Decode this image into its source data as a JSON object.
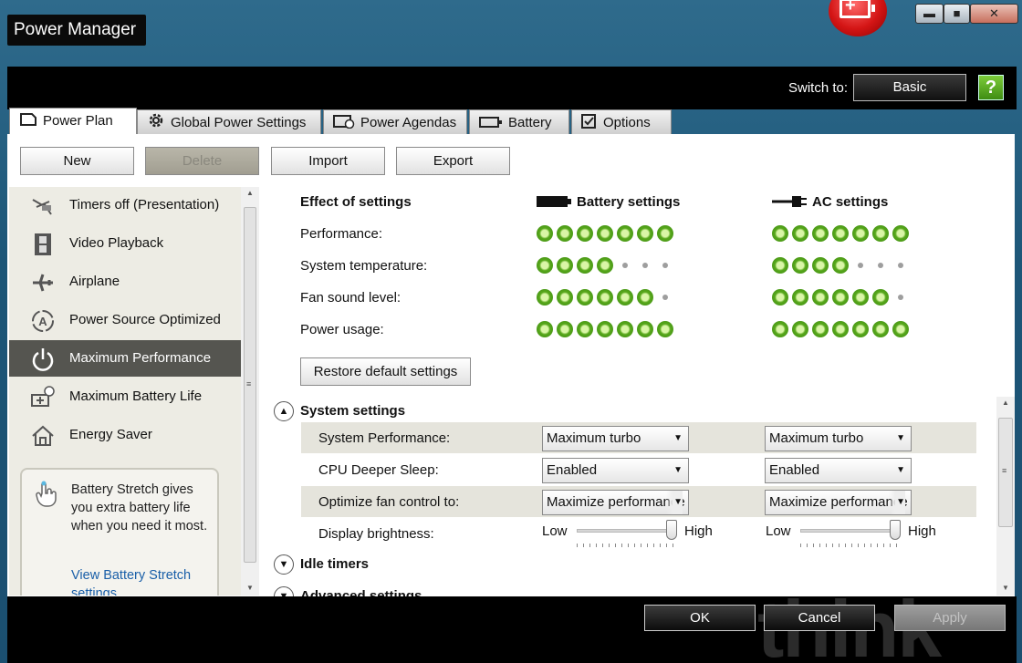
{
  "window": {
    "title": "Power Manager",
    "min_glyph": "▬",
    "max_glyph": "■",
    "close_glyph": "✕"
  },
  "topbar": {
    "switch_label": "Switch to:",
    "switch_button": "Basic",
    "help_glyph": "?"
  },
  "tabs": [
    {
      "label": "Power Plan",
      "icon": "page-icon",
      "active": true
    },
    {
      "label": "Global Power Settings",
      "icon": "gear-icon"
    },
    {
      "label": "Power Agendas",
      "icon": "calendar-clock-icon"
    },
    {
      "label": "Battery",
      "icon": "battery-icon"
    },
    {
      "label": "Options",
      "icon": "checkbox-icon"
    }
  ],
  "toolbar": {
    "new": "New",
    "delete": "Delete",
    "import": "Import",
    "export": "Export"
  },
  "plans": [
    {
      "label": "Timers off (Presentation)",
      "icon": "projector-icon"
    },
    {
      "label": "Video Playback",
      "icon": "film-icon"
    },
    {
      "label": "Airplane",
      "icon": "airplane-icon"
    },
    {
      "label": "Power Source Optimized",
      "icon": "auto-icon"
    },
    {
      "label": "Maximum Performance",
      "icon": "power-icon",
      "selected": true
    },
    {
      "label": "Maximum Battery Life",
      "icon": "battery-clock-icon"
    },
    {
      "label": "Energy Saver",
      "icon": "house-icon"
    }
  ],
  "tip": {
    "text": "Battery Stretch gives you extra battery life when you need it most.",
    "link": "View Battery Stretch settings"
  },
  "effects": {
    "heading": "Effect of settings",
    "battery_heading": "Battery settings",
    "ac_heading": "AC settings",
    "rows": [
      {
        "label": "Performance:",
        "battery": 7,
        "ac": 7
      },
      {
        "label": "System temperature:",
        "battery": 4,
        "ac": 4
      },
      {
        "label": "Fan sound level:",
        "battery": 6,
        "ac": 6
      },
      {
        "label": "Power usage:",
        "battery": 7,
        "ac": 7
      }
    ],
    "max_dots": 7,
    "restore_button": "Restore default settings"
  },
  "system_settings": {
    "heading": "System settings",
    "rows": [
      {
        "label": "System Performance:",
        "battery": "Maximum turbo",
        "ac": "Maximum turbo"
      },
      {
        "label": "CPU Deeper Sleep:",
        "battery": "Enabled",
        "ac": "Enabled"
      },
      {
        "label": "Optimize fan control to:",
        "battery": "Maximize performance",
        "ac": "Maximize performance"
      }
    ],
    "brightness": {
      "label": "Display brightness:",
      "low": "Low",
      "high": "High",
      "battery_level": 1.0,
      "ac_level": 1.0
    }
  },
  "sections": {
    "idle_timers": "Idle timers",
    "advanced": "Advanced settings"
  },
  "dialog": {
    "ok": "OK",
    "cancel": "Cancel",
    "apply": "Apply"
  },
  "brand_watermark": "think",
  "colors": {
    "dot_green": "#58a81c",
    "selected_plan": "#555550",
    "link": "#1a5fa8"
  }
}
